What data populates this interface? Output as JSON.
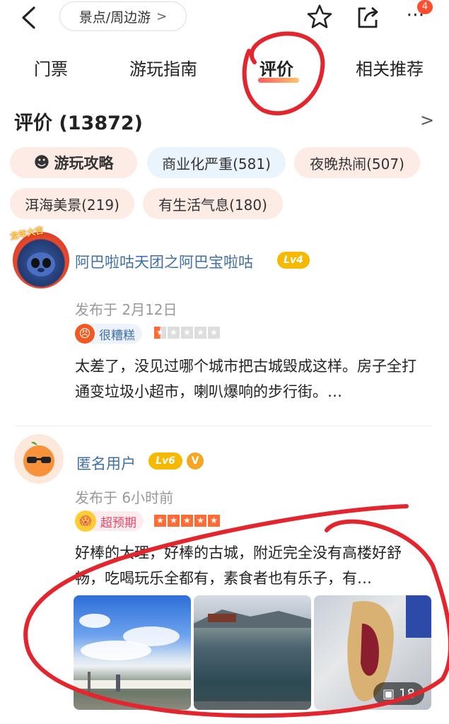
{
  "topbar": {
    "breadcrumb": "景点/周边游",
    "notification_count": "4"
  },
  "tabs": [
    {
      "label": "门票"
    },
    {
      "label": "游玩指南"
    },
    {
      "label": "评价"
    },
    {
      "label": "相关推荐"
    }
  ],
  "reviews_header": {
    "title": "评价 (13872)"
  },
  "tags": [
    {
      "label": "游玩攻略"
    },
    {
      "label": "商业化严重(581)"
    },
    {
      "label": "夜晚热闹(507)"
    },
    {
      "label": "洱海美景(219)"
    },
    {
      "label": "有生活气息(180)"
    }
  ],
  "reviews": [
    {
      "user": "阿巴啦咕天团之阿巴宝啦咕",
      "avatar_badge": "龙年大吉",
      "level": "Lv4",
      "date": "发布于 2月12日",
      "rating_label": "很糟糕",
      "stars": 1,
      "text": "太差了，没见过哪个城市把古城毁成这样。房子全打通变垃圾小超市，喇叭爆响的步行街。…"
    },
    {
      "user": "匿名用户",
      "level": "Lv6",
      "verified": "V",
      "date": "发布于 6小时前",
      "rating_label": "超预期",
      "stars": 5,
      "text": "好棒的大理，好棒的古城，附近完全没有高楼好舒畅，吃喝玩乐全都有，素食者也有乐子，有…",
      "photo_count": "18"
    }
  ],
  "colors": {
    "accent_red": "#ff4d2e",
    "link_blue": "#3f6fa8",
    "level_gold": "#f6b800",
    "star_orange": "#ff6b35",
    "annotation_red": "#e3262e"
  }
}
